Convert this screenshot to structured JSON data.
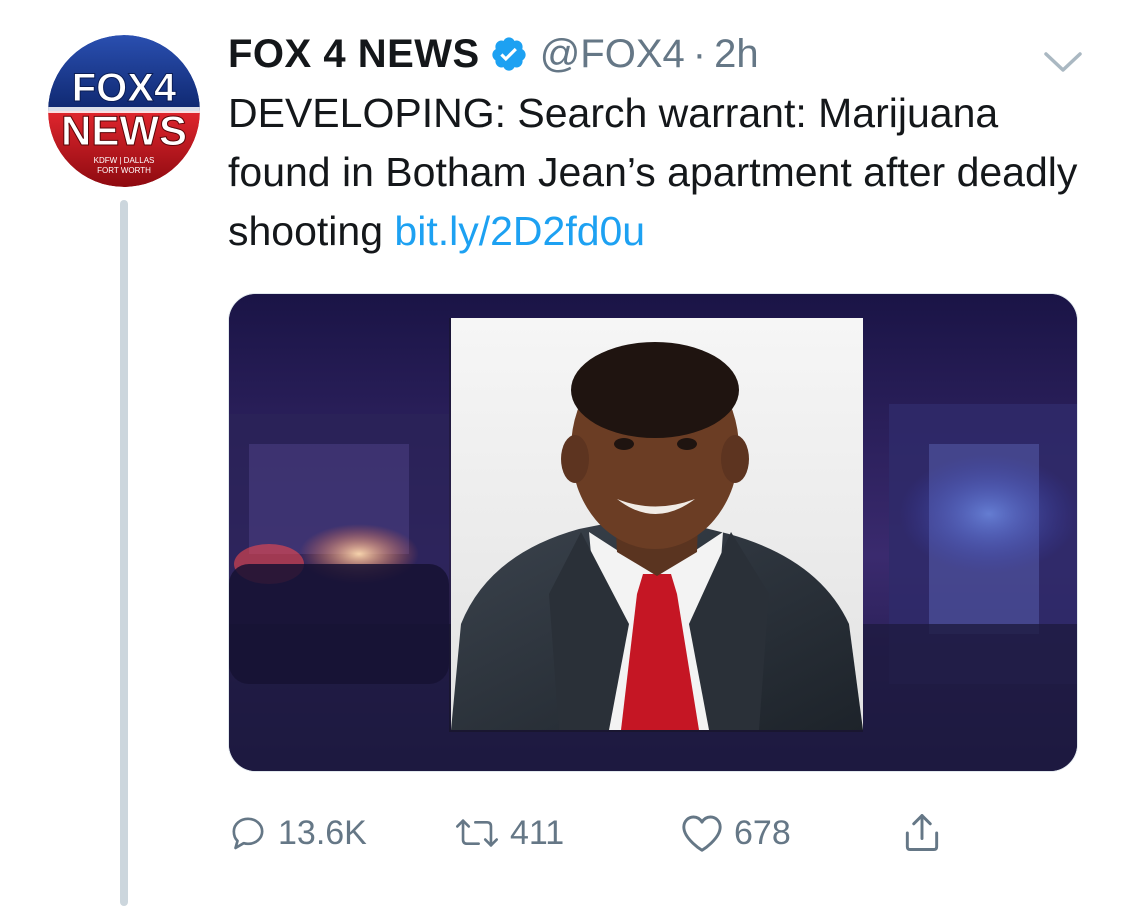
{
  "tweet": {
    "avatar": {
      "top_text": "FOX4",
      "main_text": "NEWS",
      "sub_line1": "KDFW | DALLAS",
      "sub_line2": "FORT WORTH"
    },
    "display_name": "FOX 4 NEWS",
    "handle": "@FOX4",
    "separator": "·",
    "time": "2h",
    "text": "DEVELOPING: Search warrant: Marijuana found in Botham Jean’s apartment after deadly shooting ",
    "link": "bit.ly/2D2fd0u",
    "actions": {
      "replies": "13.6K",
      "retweets": "411",
      "likes": "678"
    },
    "colors": {
      "link": "#1da1f2",
      "muted": "#657786",
      "verified": "#1da1f2",
      "brand_blue": "#1b3a8c",
      "brand_red": "#c4121a"
    }
  }
}
